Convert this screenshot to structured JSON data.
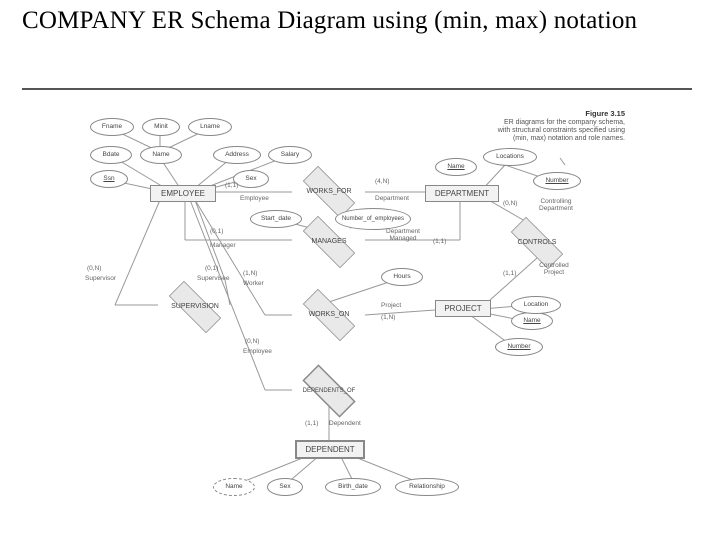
{
  "title": "COMPANY ER Schema Diagram using (min, max) notation",
  "figure": {
    "number": "Figure 3.15",
    "caption": "ER diagrams for the company schema, with structural constraints specified using (min, max) notation and role names."
  },
  "entities": {
    "employee": "EMPLOYEE",
    "department": "DEPARTMENT",
    "project": "PROJECT",
    "dependent": "DEPENDENT"
  },
  "relationships": {
    "works_for": "WORKS_FOR",
    "manages": "MANAGES",
    "supervision": "SUPERVISION",
    "controls": "CONTROLS",
    "works_on": "WORKS_ON",
    "dependents_of": "DEPENDENTS_OF"
  },
  "attributes": {
    "fname": "Fname",
    "minit": "Minit",
    "lname": "Lname",
    "bdate": "Bdate",
    "name_emp": "Name",
    "address": "Address",
    "salary": "Salary",
    "ssn": "Ssn",
    "sex_emp": "Sex",
    "start_date": "Start_date",
    "num_emp": "Number_of_employees",
    "locations": "Locations",
    "name_dept": "Name",
    "number_dept": "Number",
    "hours": "Hours",
    "name_proj": "Name",
    "location_proj": "Location",
    "number_proj": "Number",
    "name_dep": "Name",
    "sex_dep": "Sex",
    "birth_date": "Birth_date",
    "relationship": "Relationship"
  },
  "roles": {
    "employee_wf": "Employee",
    "department_wf": "Department",
    "manager": "Manager",
    "dept_managed": "Department Managed",
    "supervisor": "Supervisor",
    "supervisee": "Supervisee",
    "worker": "Worker",
    "employee_do": "Employee",
    "project_wo": "Project",
    "controlling_dept": "Controlling Department",
    "controlled_proj": "Controlled Project",
    "dependent_role": "Dependent"
  },
  "cardinalities": {
    "emp_works_for": "(1,1)",
    "dept_works_for": "(4,N)",
    "emp_manages": "(0,1)",
    "dept_manages": "(1,1)",
    "supervisor": "(0,N)",
    "supervisee": "(0,1)",
    "emp_works_on": "(1,N)",
    "proj_works_on": "(1,N)",
    "dept_controls": "(0,N)",
    "proj_controls": "(1,1)",
    "emp_dependents": "(0,N)",
    "dep_dependents": "(1,1)"
  }
}
